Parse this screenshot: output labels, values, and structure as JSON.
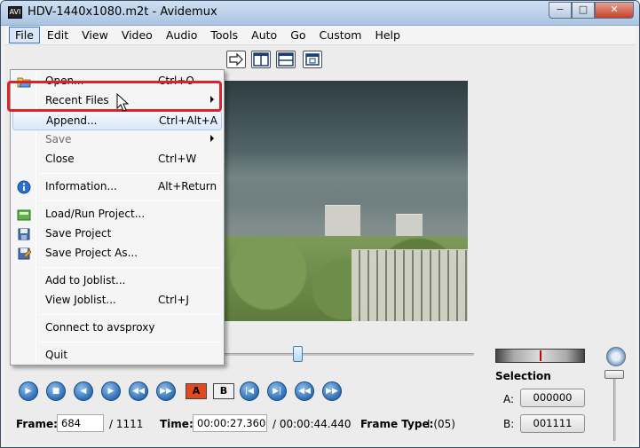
{
  "window": {
    "title": "HDV-1440x1080.m2t - Avidemux",
    "icon_text": "AVI",
    "minimize": "−",
    "maximize": "□",
    "close": "✕"
  },
  "menubar": {
    "items": [
      "File",
      "Edit",
      "View",
      "Video",
      "Audio",
      "Tools",
      "Auto",
      "Go",
      "Custom",
      "Help"
    ],
    "active": "File"
  },
  "file_menu": {
    "items": [
      {
        "label": "Open...",
        "accel": "Ctrl+O",
        "icon": "open-folder-icon"
      },
      {
        "label": "Recent Files",
        "accel": "",
        "submenu": true
      },
      {
        "label": "Append...",
        "accel": "Ctrl+Alt+A",
        "highlighted": true
      },
      {
        "label": "Save",
        "accel": "",
        "submenu": true
      },
      {
        "label": "Close",
        "accel": "Ctrl+W"
      },
      {
        "label": "Information...",
        "accel": "Alt+Return",
        "icon": "info-icon"
      },
      {
        "label": "Load/Run Project...",
        "accel": "",
        "icon": "load-project-icon"
      },
      {
        "label": "Save Project",
        "accel": "",
        "icon": "save-project-icon"
      },
      {
        "label": "Save Project As...",
        "accel": "",
        "icon": "save-project-as-icon"
      },
      {
        "label": "Add to Joblist...",
        "accel": ""
      },
      {
        "label": "View Joblist...",
        "accel": "Ctrl+J"
      },
      {
        "label": "Connect to avsproxy",
        "accel": ""
      },
      {
        "label": "Quit",
        "accel": ""
      }
    ]
  },
  "playback": {
    "marker_a": "A",
    "marker_b": "B"
  },
  "frame_info": {
    "frame_label": "Frame:",
    "frame_value": "684",
    "frame_total": "/ 1111",
    "time_label": "Time:",
    "time_value": "00:00:27.360",
    "time_total": "/ 00:00:44.440",
    "frame_type_label": "Frame Type:",
    "frame_type_value": "I (05)"
  },
  "selection": {
    "title": "Selection",
    "a_label": "A:",
    "a_value": "000000",
    "b_label": "B:",
    "b_value": "001111"
  },
  "colors": {
    "highlight_border": "#d9242c",
    "menu_hover": "#dbe9f9",
    "nav_button": "#2e6db3"
  }
}
